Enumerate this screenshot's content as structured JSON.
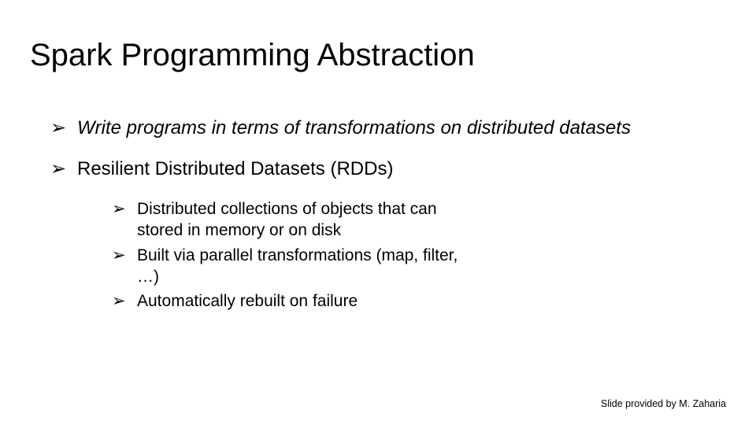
{
  "slide": {
    "title": "Spark Programming Abstraction",
    "bullets": {
      "b1": {
        "marker": "➢",
        "text": "Write programs in terms of transformations on distributed datasets"
      },
      "b2": {
        "marker": "➢",
        "text": "Resilient Distributed Datasets (RDDs)",
        "sub": {
          "s1": {
            "marker": "➢",
            "text": "Distributed collections of objects that can stored in memory or on disk"
          },
          "s2": {
            "marker": "➢",
            "text": "Built via parallel transformations (map, filter, …)"
          },
          "s3": {
            "marker": "➢",
            "text": "Automatically rebuilt on failure"
          }
        }
      }
    },
    "footer": "Slide provided by M. Zaharia"
  }
}
